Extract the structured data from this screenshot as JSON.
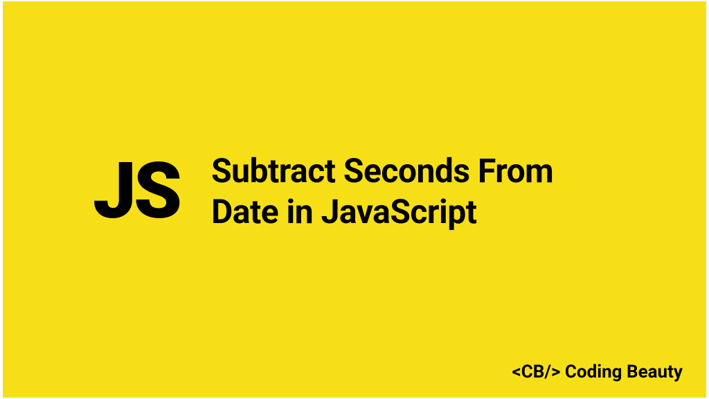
{
  "logo": {
    "text": "JS"
  },
  "title": {
    "line1": "Subtract Seconds From",
    "line2": "Date in JavaScript"
  },
  "footer": {
    "tag": "<CB/>",
    "brand": "Coding Beauty"
  }
}
